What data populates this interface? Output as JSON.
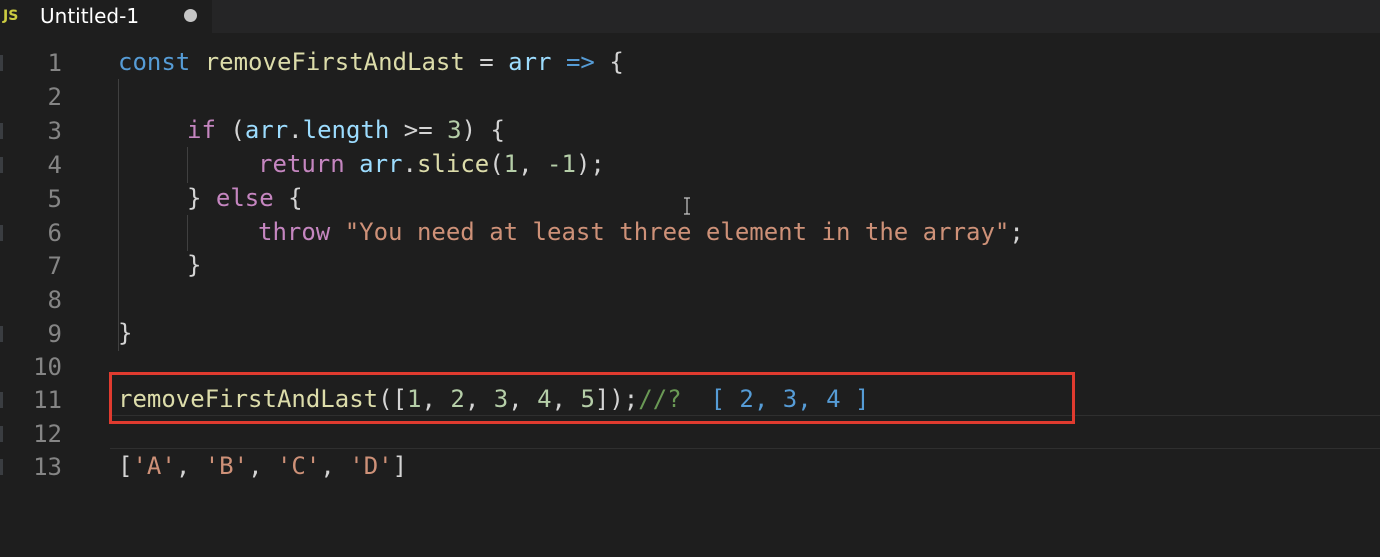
{
  "tab": {
    "lang_badge": "JS",
    "title": "Untitled-1",
    "unsaved": true
  },
  "line_numbers": [
    "1",
    "2",
    "3",
    "4",
    "5",
    "6",
    "7",
    "8",
    "9",
    "10",
    "11",
    "12",
    "13"
  ],
  "code": {
    "l1": {
      "kw": "const",
      "name": "removeFirstAndLast",
      "eq": " = ",
      "param": "arr",
      "arrow": " => ",
      "brace": "{"
    },
    "l3": {
      "kw": "if",
      "open": " (",
      "obj": "arr",
      "dot": ".",
      "prop": "length",
      "op": " >= ",
      "num": "3",
      "close": ") {"
    },
    "l4": {
      "kw": "return",
      "sp": " ",
      "obj": "arr",
      "dot": ".",
      "method": "slice",
      "open": "(",
      "a1": "1",
      "comma": ", ",
      "a2": "-1",
      "close": ");"
    },
    "l5": {
      "brace": "} ",
      "kw": "else",
      "open": " {"
    },
    "l6": {
      "kw": "throw",
      "sp": " ",
      "str": "\"You need at least three element in the array\"",
      "semi": ";"
    },
    "l7": {
      "brace": "}"
    },
    "l9": {
      "brace": "}"
    },
    "l11": {
      "call": "removeFirstAndLast",
      "args": "([",
      "n1": "1",
      "c1": ", ",
      "n2": "2",
      "c2": ", ",
      "n3": "3",
      "c3": ", ",
      "n4": "4",
      "c4": ", ",
      "n5": "5",
      "end": "]);",
      "comment": "//?",
      "result": "  [ 2, 3, 4 ]"
    },
    "l13": {
      "open": "[",
      "s1": "'A'",
      "c1": ", ",
      "s2": "'B'",
      "c2": ", ",
      "s3": "'C'",
      "c3": ", ",
      "s4": "'D'",
      "close": "]"
    }
  },
  "colors": {
    "background": "#1e1e1e",
    "keyword": "#569cd6",
    "control": "#c586c0",
    "function": "#dcdcaa",
    "variable": "#9cdcfe",
    "number": "#b5cea8",
    "string": "#ce9178",
    "comment": "#6a9955",
    "highlight_box": "#e03b2f"
  },
  "icons": {
    "unsaved_dot": "unsaved-dot-icon",
    "text_cursor": "text-cursor-icon"
  }
}
